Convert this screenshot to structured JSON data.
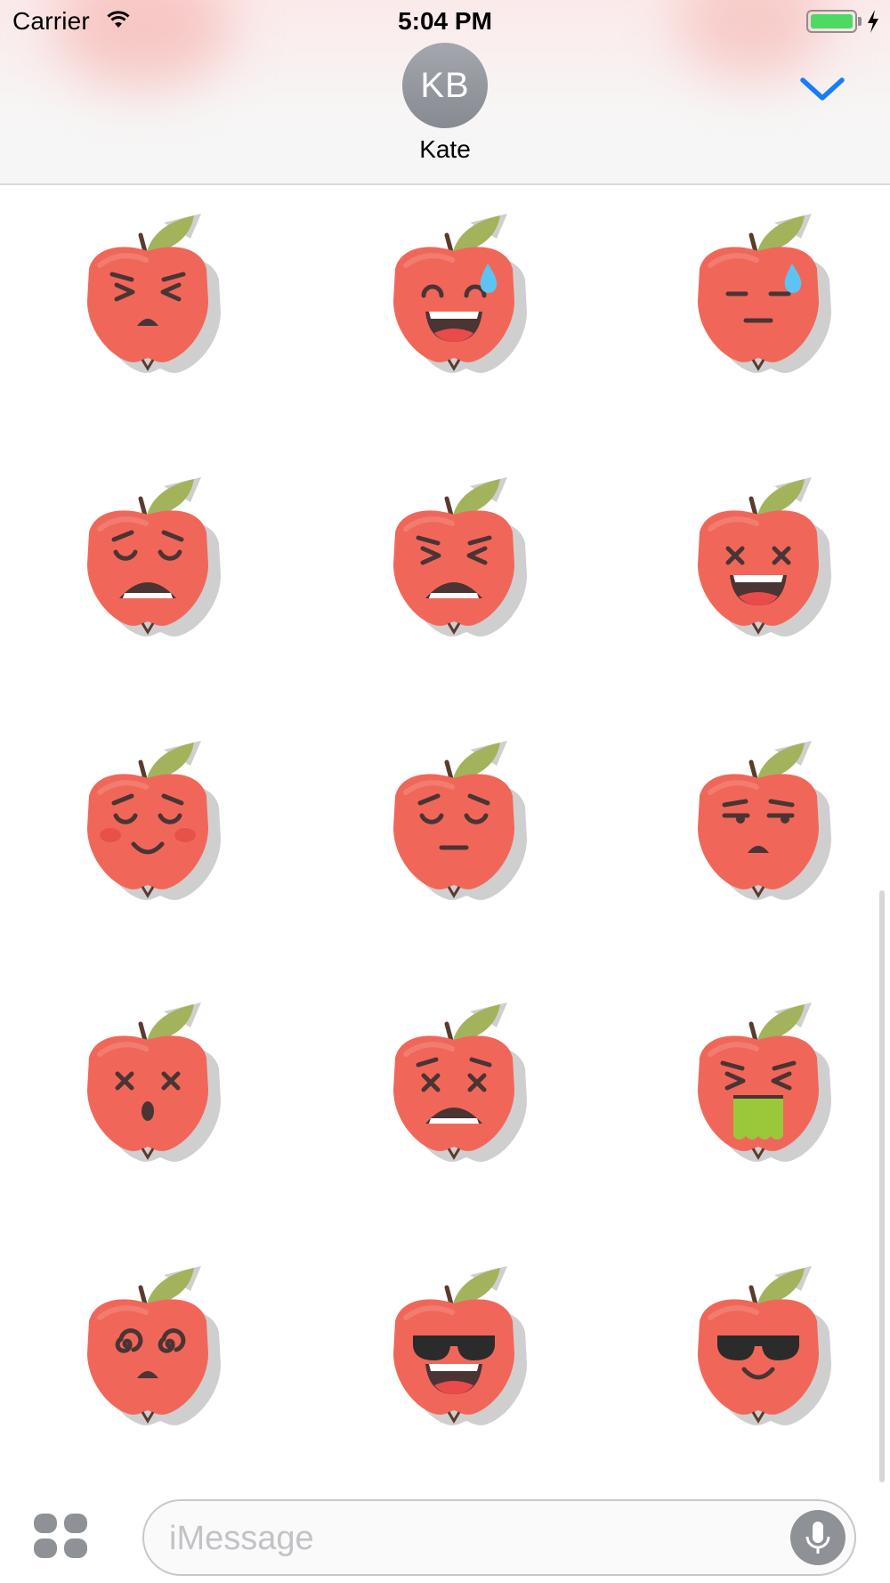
{
  "status_bar": {
    "carrier": "Carrier",
    "time": "5:04 PM",
    "battery_level": 1.0
  },
  "conversation": {
    "avatar_initials": "KB",
    "contact_name": "Kate"
  },
  "composer": {
    "placeholder": "iMessage"
  },
  "stickers": [
    {
      "name": "sticker-apple-squinting-frown",
      "eyes": "squint",
      "mouth": "small-frown",
      "extra": "none"
    },
    {
      "name": "sticker-apple-sweat-laugh",
      "eyes": "happy-arc",
      "mouth": "laugh-open",
      "extra": "sweat-drop"
    },
    {
      "name": "sticker-apple-sweat-neutral",
      "eyes": "line",
      "mouth": "flat",
      "extra": "sweat-drop"
    },
    {
      "name": "sticker-apple-weary",
      "eyes": "sad-arc",
      "mouth": "open-frown",
      "extra": "none"
    },
    {
      "name": "sticker-apple-tired-face",
      "eyes": "squint",
      "mouth": "open-frown",
      "extra": "none"
    },
    {
      "name": "sticker-apple-x-eyes-laugh",
      "eyes": "x",
      "mouth": "laugh-open",
      "extra": "none"
    },
    {
      "name": "sticker-apple-blushing-smile",
      "eyes": "sad-arc",
      "mouth": "smile",
      "extra": "blush"
    },
    {
      "name": "sticker-apple-pensive",
      "eyes": "sad-arc",
      "mouth": "flat",
      "extra": "none"
    },
    {
      "name": "sticker-apple-unamused",
      "eyes": "side-glance",
      "mouth": "small-frown",
      "extra": "none"
    },
    {
      "name": "sticker-apple-dizzy-surprised",
      "eyes": "x",
      "mouth": "o",
      "extra": "none"
    },
    {
      "name": "sticker-apple-x-eyes-frown",
      "eyes": "x-brows",
      "mouth": "open-frown",
      "extra": "none"
    },
    {
      "name": "sticker-apple-vomiting",
      "eyes": "squint",
      "mouth": "vomit",
      "extra": "none"
    },
    {
      "name": "sticker-apple-spiral-eyes",
      "eyes": "spiral",
      "mouth": "small-frown",
      "extra": "none"
    },
    {
      "name": "sticker-apple-sunglasses-laugh",
      "eyes": "sunglasses",
      "mouth": "laugh-open",
      "extra": "none"
    },
    {
      "name": "sticker-apple-sunglasses-smile",
      "eyes": "sunglasses",
      "mouth": "smile",
      "extra": "none"
    }
  ],
  "colors": {
    "apple": "#f0675a",
    "apple_highlight": "#f48a7d",
    "shadow": "#cfcfcf",
    "leaf": "#a3b35c",
    "stem": "#5b3b2e",
    "face": "#4a3434",
    "tongue": "#e94b4b",
    "drop": "#5ec3f2",
    "vomit": "#9ac83a",
    "accent_blue": "#147efb"
  }
}
